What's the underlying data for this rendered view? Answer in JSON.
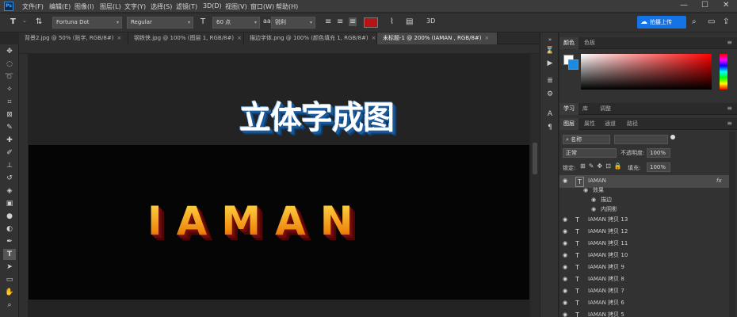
{
  "app": {
    "logo": "Ps"
  },
  "menu": [
    "文件(F)",
    "编辑(E)",
    "图像(I)",
    "图层(L)",
    "文字(Y)",
    "选择(S)",
    "滤镜(T)",
    "3D(D)",
    "视图(V)",
    "窗口(W)",
    "帮助(H)"
  ],
  "window_controls": [
    "—",
    "☐",
    "✕"
  ],
  "options": {
    "tool_icon": "T",
    "font_family": "Fortuna Dot",
    "font_style": "Regular",
    "font_size": "60 点",
    "aa_label": "aa",
    "anti_alias": "锐利",
    "text_color": "#b81414",
    "upload_label": "拍摄上传"
  },
  "tabs": [
    {
      "label": "背景2.jpg @ 50% (贴字, RGB/8#)",
      "active": false
    },
    {
      "label": "钢铁侠.jpg @ 100% (图层 1, RGB/8#)",
      "active": false
    },
    {
      "label": "描边字体.png @ 100% (颜色填充 1, RGB/8#)",
      "active": false
    },
    {
      "label": "未标题-1 @ 200% (IAMAN , RGB/8#)",
      "active": true
    }
  ],
  "canvas": {
    "headline": "立体字成图",
    "art_text": "IAMAN"
  },
  "color_panel": {
    "tabs": [
      "颜色",
      "色板"
    ],
    "foreground": "#ffffff",
    "background": "#1a8be0"
  },
  "learn_tabs": [
    "学习",
    "库",
    "调整"
  ],
  "layers_panel": {
    "tabs": [
      "图层",
      "属性",
      "通道",
      "路径"
    ],
    "filter_label": "名称",
    "blend_mode": "正常",
    "opacity_label": "不透明度:",
    "opacity_value": "100%",
    "lock_label": "锁定:",
    "fill_label": "填充:",
    "fill_value": "100%",
    "layers": [
      {
        "name": "IAMAN",
        "fx": "fx",
        "selected": true
      },
      {
        "name": "效果",
        "sub": true
      },
      {
        "name": "描边",
        "sub": true
      },
      {
        "name": "内阴影",
        "sub": true
      },
      {
        "name": "IAMAN  拷贝 13"
      },
      {
        "name": "IAMAN  拷贝 12"
      },
      {
        "name": "IAMAN  拷贝 11"
      },
      {
        "name": "IAMAN  拷贝 10"
      },
      {
        "name": "IAMAN  拷贝 9"
      },
      {
        "name": "IAMAN  拷贝 8"
      },
      {
        "name": "IAMAN  拷贝 7"
      },
      {
        "name": "IAMAN  拷贝 6"
      },
      {
        "name": "IAMAN  拷贝 5"
      }
    ]
  }
}
